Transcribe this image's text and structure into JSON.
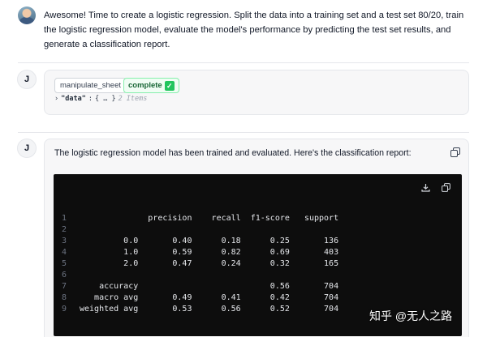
{
  "user_message": {
    "text": "Awesome! Time to create a logistic regression. Split the data into a training set and a test set 80/20, train the logistic regression model, evaluate the model's performance by predicting the test set results, and generate a classification report."
  },
  "tool_call": {
    "avatar_letter": "J",
    "tool_name": "manipulate_sheet",
    "status": "complete",
    "status_icon": "✓",
    "json_caret": "›",
    "json_key": "\"data\"",
    "json_colon": ":",
    "json_collapsed": "{ … }",
    "json_count": "2 Items"
  },
  "assistant_message": {
    "avatar_letter": "J",
    "text": "The logistic regression model has been trained and evaluated. Here's the classification report:",
    "code_lines": [
      {
        "n": "1",
        "text": "              precision    recall  f1-score   support"
      },
      {
        "n": "2",
        "text": ""
      },
      {
        "n": "3",
        "text": "         0.0       0.40      0.18      0.25       136"
      },
      {
        "n": "4",
        "text": "         1.0       0.59      0.82      0.69       403"
      },
      {
        "n": "5",
        "text": "         2.0       0.47      0.24      0.32       165"
      },
      {
        "n": "6",
        "text": ""
      },
      {
        "n": "7",
        "text": "    accuracy                           0.56       704"
      },
      {
        "n": "8",
        "text": "   macro avg       0.49      0.41      0.42       704"
      },
      {
        "n": "9",
        "text": "weighted avg       0.53      0.56      0.52       704"
      }
    ]
  },
  "watermark": "知乎 @无人之路"
}
